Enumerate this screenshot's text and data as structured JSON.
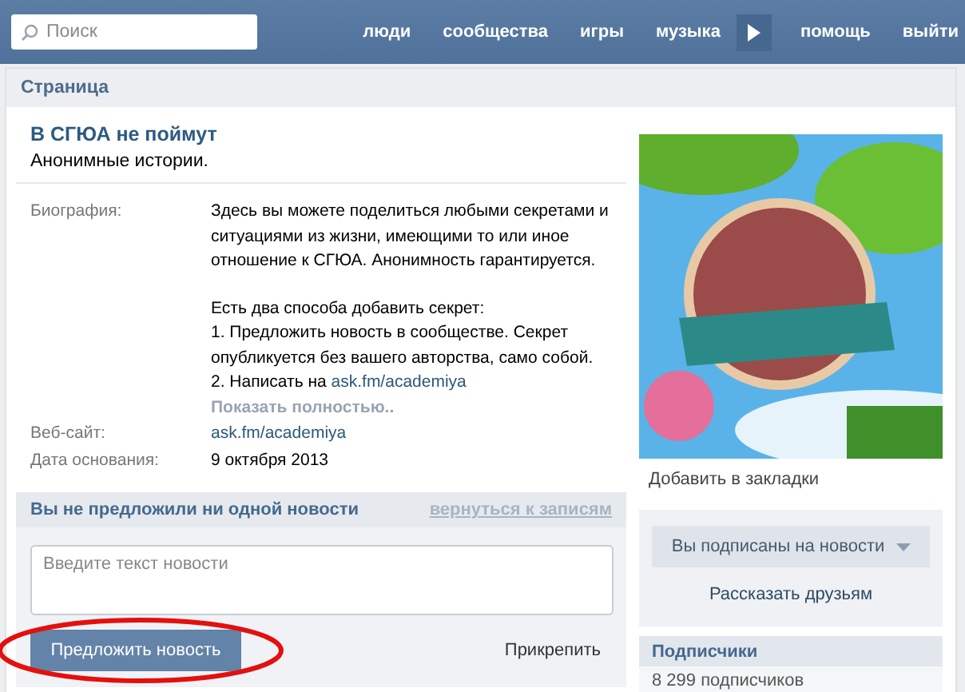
{
  "search": {
    "placeholder": "Поиск"
  },
  "nav": [
    {
      "kind": "link",
      "label": "люди"
    },
    {
      "kind": "link",
      "label": "сообщества"
    },
    {
      "kind": "link",
      "label": "игры"
    },
    {
      "kind": "link",
      "label": "музыка"
    },
    {
      "kind": "player"
    },
    {
      "kind": "link",
      "label": "помощь"
    },
    {
      "kind": "link",
      "label": "выйти"
    }
  ],
  "page": {
    "header": "Страница"
  },
  "group": {
    "name": "В СГЮА не поймут",
    "status": "Анонимные истории.",
    "bio": {
      "label": "Биография:",
      "intro": "Здесь вы можете поделиться любыми секретами и ситуациями из жизни, имеющими то или иное отношение к СГЮА. Анонимность гарантируется.",
      "lines": [
        {
          "text": "Есть два способа добавить секрет:"
        },
        {
          "text": "1. Предложить новость в сообществе. Секрет опубликуется без вашего авторства, само собой."
        },
        {
          "text": "2. Написать на ",
          "link": "ask.fm/academiya"
        }
      ],
      "more": "Показать полностью.."
    },
    "info": [
      {
        "label": "Веб-сайт:",
        "value": "ask.fm/academiya",
        "kind": "link"
      },
      {
        "label": "Дата основания:",
        "value": "9 октября 2013",
        "kind": "text"
      }
    ]
  },
  "suggest": {
    "title": "Вы не предложили ни одной новости",
    "back_link": "вернуться к записям",
    "input": {
      "placeholder": "Введите текст новости"
    },
    "submit": "Предложить новость",
    "attach": "Прикрепить",
    "highlighted": true
  },
  "sidebar": {
    "bookmark": "Добавить в закладки",
    "subscribe_button": "Вы подписаны на новости",
    "share": "Рассказать друзьям",
    "subscribers": {
      "title": "Подписчики",
      "count": "8 299 подписчиков"
    }
  }
}
